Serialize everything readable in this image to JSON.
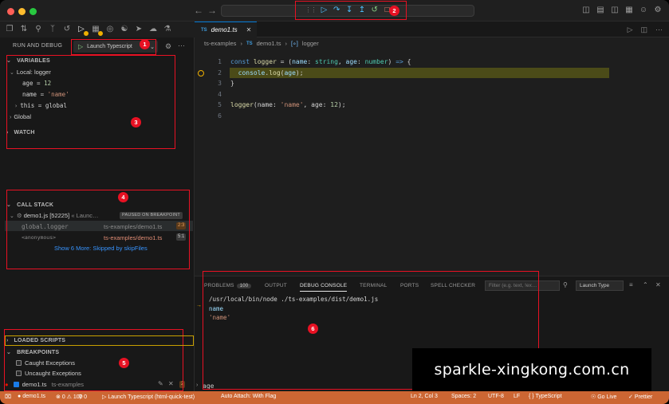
{
  "sidebar": {
    "run_title": "RUN AND DEBUG",
    "launch_config": "Launch Typescript",
    "variables": {
      "title": "VARIABLES",
      "scope_local": "Local: logger",
      "items": [
        {
          "name": "age",
          "value": "12",
          "kind": "num"
        },
        {
          "name": "name",
          "value": "'name'",
          "kind": "str"
        },
        {
          "name": "this",
          "value": "global",
          "kind": "plain"
        }
      ],
      "scope_global": "Global"
    },
    "watch_title": "WATCH",
    "call_stack": {
      "title": "CALL STACK",
      "thread": "demo1.js [52225]",
      "thread_suffix": "« Launc…",
      "paused_badge": "PAUSED ON BREAKPOINT",
      "frames": [
        {
          "name": "global.logger",
          "file": "ts-examples/demo1.ts",
          "loc": "2:3"
        },
        {
          "name": "<anonymous>",
          "file": "ts-examples/demo1.ts",
          "loc": "5:1"
        }
      ],
      "show_more": "Show 6 More: Skipped by skipFiles"
    },
    "loaded_scripts_title": "LOADED SCRIPTS",
    "breakpoints": {
      "title": "BREAKPOINTS",
      "items": [
        {
          "label": "Caught Exceptions",
          "checked": false
        },
        {
          "label": "Uncaught Exceptions",
          "checked": false
        }
      ],
      "file_item": {
        "label": "demo1.ts",
        "path": "ts-examples",
        "count": "2"
      }
    }
  },
  "editor": {
    "tab_badge": "TS",
    "tab_name": "demo1.ts",
    "breadcrumb": [
      "ts-examples",
      "demo1.ts",
      "logger"
    ],
    "breadcrumb_ts_badge": "TS",
    "breadcrumb_symbol": "[∘]",
    "line_numbers": [
      "1",
      "2",
      "3",
      "4",
      "5",
      "6"
    ]
  },
  "panel": {
    "tabs": [
      "PROBLEMS",
      "OUTPUT",
      "DEBUG CONSOLE",
      "TERMINAL",
      "PORTS",
      "SPELL CHECKER"
    ],
    "problems_count": "100",
    "filter_placeholder": "Filter (e.g. text, !ex…",
    "launch_select": "Launch Type",
    "console_lines": [
      "/usr/local/bin/node ./ts-examples/dist/demo1.js",
      "name",
      "'name'"
    ],
    "repl_input": "age"
  },
  "statusbar": {
    "debug_icon": "⌧",
    "file_info": "demo1.ts",
    "errors": "0",
    "warnings": "100",
    "ports": "0",
    "launch": "Launch Typescript (html-quick-test)",
    "auto_attach": "Auto Attach: With Flag",
    "position": "Ln 2, Col 3",
    "spaces": "Spaces: 2",
    "encoding": "UTF-8",
    "eol": "LF",
    "language": "TypeScript",
    "golive": "Go Live",
    "prettier": "Prettier"
  },
  "annotations": [
    "1",
    "2",
    "3",
    "4",
    "5",
    "6"
  ],
  "watermark": "sparkle-xingkong.com.cn",
  "colors": {
    "accent": "#0078d4",
    "statusbar": "#cc6633",
    "annotation": "#e81123",
    "breakpoint_highlight": "#4b4b18"
  }
}
